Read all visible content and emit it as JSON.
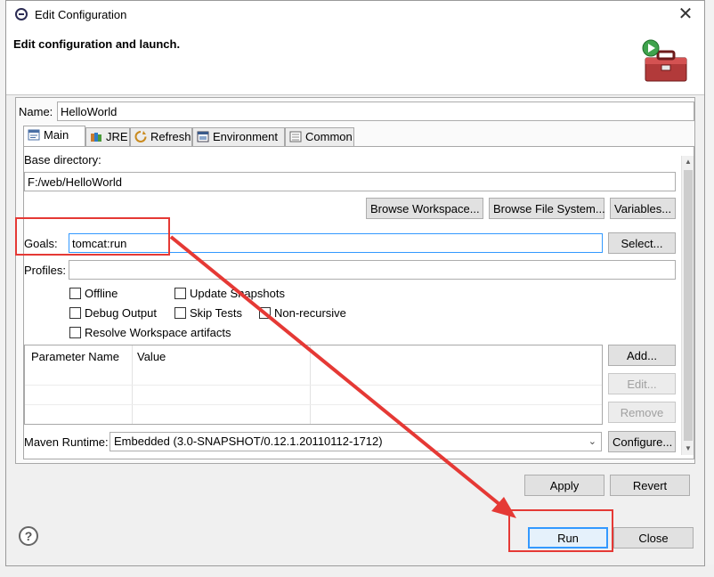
{
  "window": {
    "title": "Edit Configuration",
    "banner": "Edit configuration and launch."
  },
  "name_field": {
    "label": "Name:",
    "value": "HelloWorld"
  },
  "tabs": [
    {
      "label": "Main",
      "icon": "main-tab-icon",
      "active": true
    },
    {
      "label": "JRE",
      "icon": "jre-icon"
    },
    {
      "label": "Refresh",
      "icon": "refresh-icon"
    },
    {
      "label": "Environment",
      "icon": "environment-icon"
    },
    {
      "label": "Common",
      "icon": "common-icon"
    }
  ],
  "main": {
    "base_directory_label": "Base directory:",
    "base_directory_value": "F:/web/HelloWorld",
    "browse_workspace": "Browse Workspace...",
    "browse_file_system": "Browse File System...",
    "variables": "Variables...",
    "goals_label": "Goals:",
    "goals_value": "tomcat:run",
    "select": "Select...",
    "profiles_label": "Profiles:",
    "profiles_value": "",
    "checkboxes": {
      "offline": "Offline",
      "update_snapshots": "Update Snapshots",
      "debug_output": "Debug Output",
      "skip_tests": "Skip Tests",
      "non_recursive": "Non-recursive",
      "resolve_workspace": "Resolve Workspace artifacts"
    },
    "param_table": {
      "col_name": "Parameter Name",
      "col_value": "Value"
    },
    "add": "Add...",
    "edit": "Edit...",
    "remove": "Remove",
    "maven_runtime_label": "Maven Runtime:",
    "maven_runtime_value": "Embedded (3.0-SNAPSHOT/0.12.1.20110112-1712)",
    "configure": "Configure..."
  },
  "actions": {
    "apply": "Apply",
    "revert": "Revert",
    "run": "Run",
    "close": "Close"
  },
  "help_glyph": "?",
  "colors": {
    "annotation": "#e53935",
    "focus": "#3399ff"
  }
}
